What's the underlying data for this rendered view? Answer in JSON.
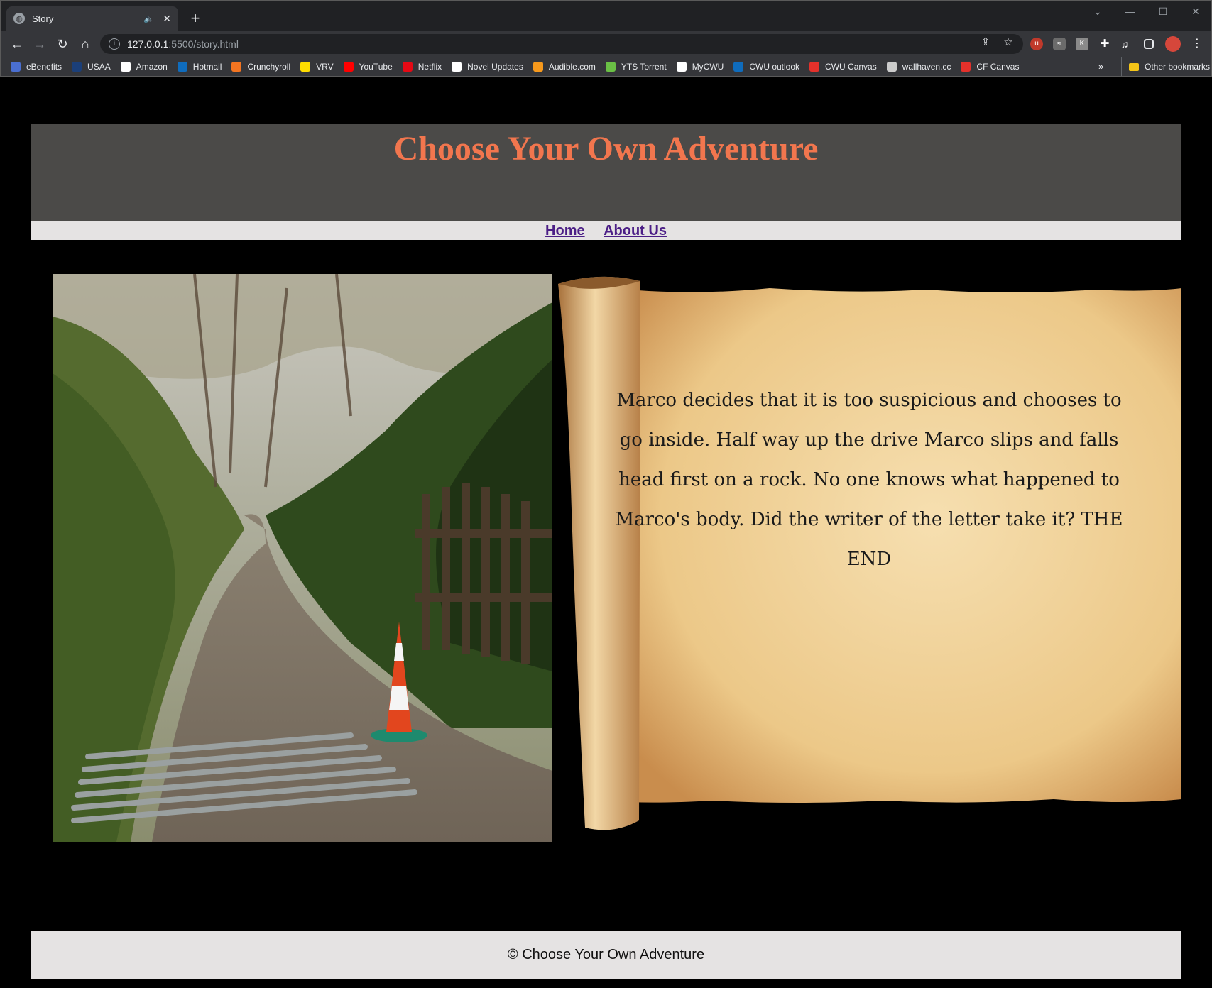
{
  "browser": {
    "tab": {
      "title": "Story"
    },
    "url": {
      "host": "127.0.0.1",
      "path": ":5500/story.html"
    },
    "bookmarks": [
      {
        "label": "eBenefits",
        "color": "#4a6fd1",
        "icon": "ebenefits-icon"
      },
      {
        "label": "USAA",
        "color": "#1b3f79",
        "icon": "usaa-icon"
      },
      {
        "label": "Amazon",
        "color": "#ffffff",
        "icon": "amazon-icon"
      },
      {
        "label": "Hotmail",
        "color": "#0f6cbd",
        "icon": "outlook-icon"
      },
      {
        "label": "Crunchyroll",
        "color": "#f47521",
        "icon": "crunchyroll-icon"
      },
      {
        "label": "VRV",
        "color": "#ffdd00",
        "icon": "vrv-icon"
      },
      {
        "label": "YouTube",
        "color": "#ff0000",
        "icon": "youtube-icon"
      },
      {
        "label": "Netflix",
        "color": "#e50914",
        "icon": "netflix-icon"
      },
      {
        "label": "Novel Updates",
        "color": "#ffffff",
        "icon": "novel-updates-icon"
      },
      {
        "label": "Audible.com",
        "color": "#f7991c",
        "icon": "audible-icon"
      },
      {
        "label": "YTS Torrent",
        "color": "#6ac045",
        "icon": "yts-icon"
      },
      {
        "label": "MyCWU",
        "color": "#ffffff",
        "icon": "globe-icon"
      },
      {
        "label": "CWU outlook",
        "color": "#0f6cbd",
        "icon": "outlook-icon"
      },
      {
        "label": "CWU Canvas",
        "color": "#e4312b",
        "icon": "canvas-icon"
      },
      {
        "label": "wallhaven.cc",
        "color": "#cccccc",
        "icon": "wallhaven-icon"
      },
      {
        "label": "CF Canvas",
        "color": "#e4312b",
        "icon": "canvas-icon"
      }
    ],
    "more_bookmarks": "»",
    "other_bookmarks": "Other bookmarks"
  },
  "site": {
    "title": "Choose Your Own Adventure",
    "nav": [
      {
        "label": "Home"
      },
      {
        "label": "About Us"
      }
    ],
    "story_text": "Marco decides that it is too suspicious and chooses to go inside. Half way up the drive Marco slips and falls head first on a rock. No one knows what happened to Marco's body. Did the writer of the letter take it? THE END",
    "footer": "© Choose Your Own Adventure"
  },
  "colors": {
    "title": "#f2764e",
    "header_bg": "#4b4a48",
    "nav_bg": "#e5e3e3",
    "link": "#4b1e86",
    "page_bg": "#000000"
  }
}
